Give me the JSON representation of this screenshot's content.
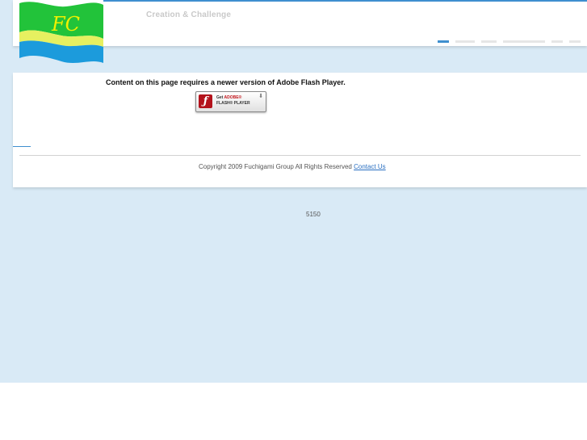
{
  "header": {
    "logo_text": "FC",
    "tagline": "Creation & Challenge",
    "nav_bars": [
      {
        "state": "active",
        "color": "#3f8fcf"
      },
      {
        "state": "inactive",
        "color": "#e6e6e6"
      },
      {
        "state": "inactive",
        "color": "#e6e6e6"
      },
      {
        "state": "inactive",
        "color": "#e6e6e6"
      },
      {
        "state": "inactive",
        "color": "#e6e6e6"
      },
      {
        "state": "inactive",
        "color": "#e6e6e6"
      }
    ]
  },
  "flash": {
    "message": "Content on this page requires a newer version of Adobe Flash Player.",
    "button_get": "Get ",
    "button_adobe": "ADOBE®",
    "button_player": "FLASH® PLAYER",
    "icon": "flash-icon"
  },
  "footer": {
    "copyright": "Copyright 2009 Fuchigami Group All Rights Reserved ",
    "contact_link": "Contact Us"
  },
  "counter": "5150",
  "colors": {
    "page_background": "#d9eaf6",
    "accent": "#3f8fcf",
    "logo_green": "#22c33a",
    "logo_blue": "#1c9bdc",
    "logo_yellow": "#f0f000"
  }
}
